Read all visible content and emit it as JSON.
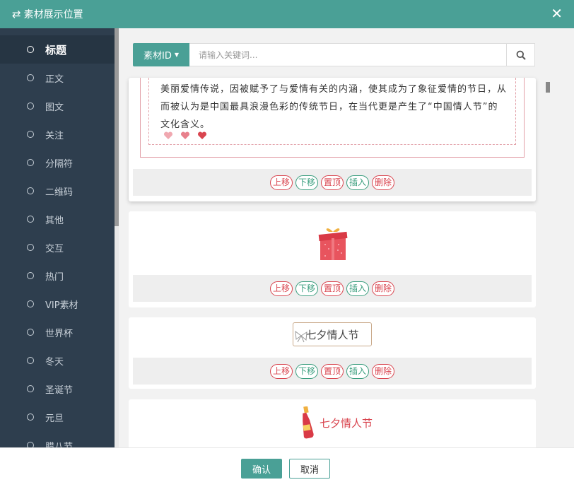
{
  "window": {
    "title": "素材展示位置",
    "close_icon": "close-icon",
    "title_icon": "swap-arrows-icon"
  },
  "sidebar": {
    "items": [
      {
        "label": "标题",
        "active": true
      },
      {
        "label": "正文"
      },
      {
        "label": "图文"
      },
      {
        "label": "关注"
      },
      {
        "label": "分隔符"
      },
      {
        "label": "二维码"
      },
      {
        "label": "其他"
      },
      {
        "label": "交互"
      },
      {
        "label": "热门"
      },
      {
        "label": "VIP素材"
      },
      {
        "label": "世界杯"
      },
      {
        "label": "冬天"
      },
      {
        "label": "圣诞节"
      },
      {
        "label": "元旦"
      },
      {
        "label": "腊八节"
      }
    ]
  },
  "search": {
    "dropdown_label": "素材ID",
    "placeholder": "请输入关键词...",
    "button_icon": "search-icon"
  },
  "cards": [
    {
      "text": "美丽爱情传说，因被赋予了与爱情有关的内涵，使其成为了象征爱情的节日，从而被认为是中国最具浪漫色彩的传统节日，在当代更是产生了“中国情人节”的文化含义。"
    },
    {
      "image": "gift-box-icon"
    },
    {
      "text": "七夕情人节"
    },
    {
      "text": "七夕情人节",
      "image": "wine-bottle-icon"
    }
  ],
  "actions": {
    "up": "上移",
    "down": "下移",
    "top": "置顶",
    "insert": "插入",
    "delete": "删除"
  },
  "footer": {
    "confirm": "确认",
    "cancel": "取消"
  },
  "colors": {
    "accent": "#4aa096",
    "sidebar": "#2e3e4e",
    "danger": "#d9454f",
    "success": "#3a9e7e"
  }
}
